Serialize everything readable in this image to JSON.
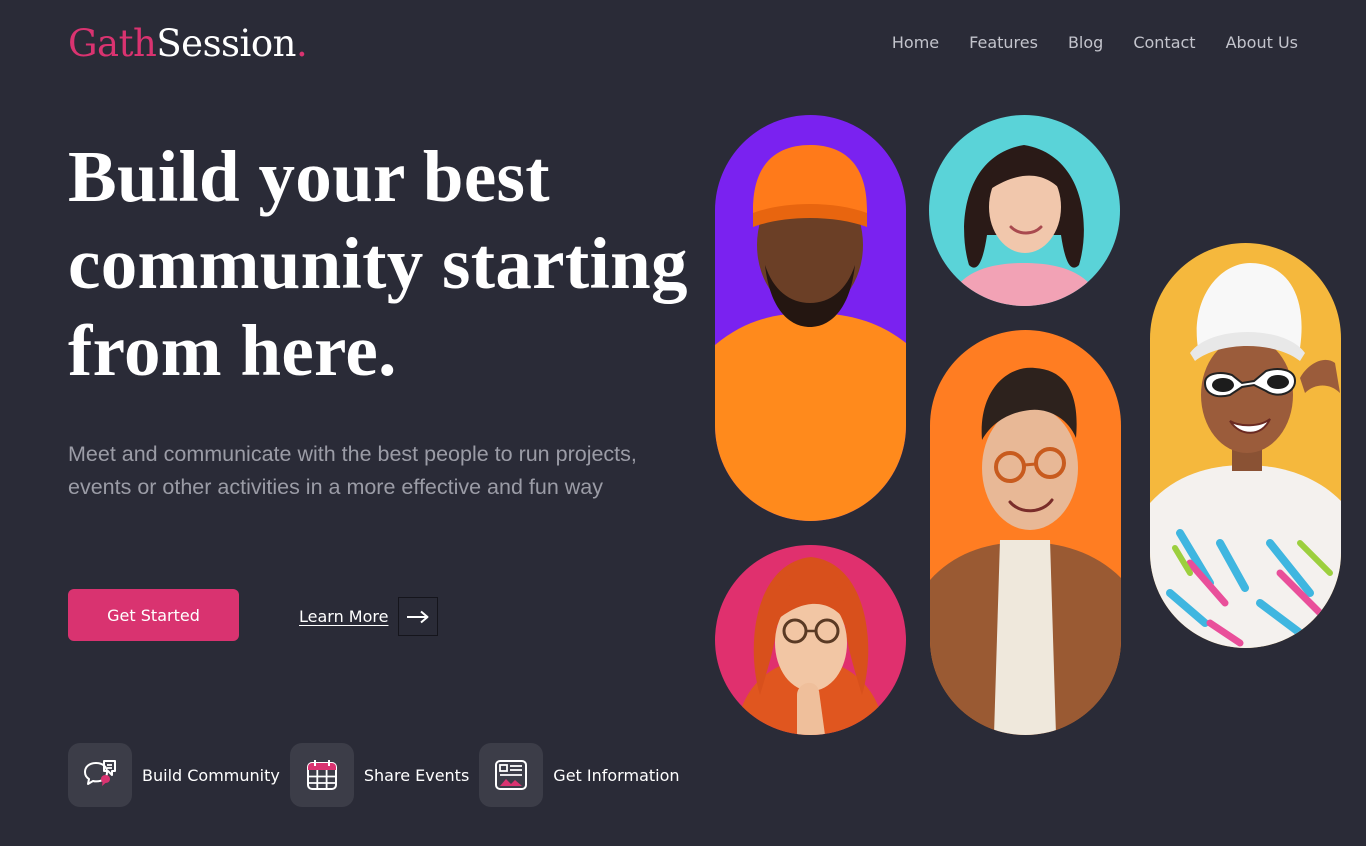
{
  "brand": {
    "part1": "Gath",
    "part2": "Session",
    "dot": "."
  },
  "nav": [
    "Home",
    "Features",
    "Blog",
    "Contact",
    "About Us"
  ],
  "hero": {
    "headline": "Build your best community starting from here.",
    "subtitle": "Meet and communicate with the best people to run projects, events or other activities in a more effective and fun way",
    "primary_cta": "Get Started",
    "secondary_cta": "Learn More"
  },
  "features": [
    {
      "label": "Build Community",
      "icon": "chat-bubbles-icon"
    },
    {
      "label": "Share Events",
      "icon": "calendar-icon"
    },
    {
      "label": "Get Information",
      "icon": "news-article-icon"
    }
  ],
  "photos": [
    {
      "name": "photo-man-orange-beanie",
      "bg": "#7a22f0"
    },
    {
      "name": "photo-woman-smiling",
      "bg": "#5ad3d8"
    },
    {
      "name": "photo-man-glasses",
      "bg": "#ff7d22"
    },
    {
      "name": "photo-woman-thinking",
      "bg": "#e0306e"
    },
    {
      "name": "photo-woman-sunglasses",
      "bg": "#f5b83d"
    }
  ],
  "colors": {
    "accent": "#d93370",
    "background": "#2a2b37",
    "pill": "#3c3d48"
  }
}
